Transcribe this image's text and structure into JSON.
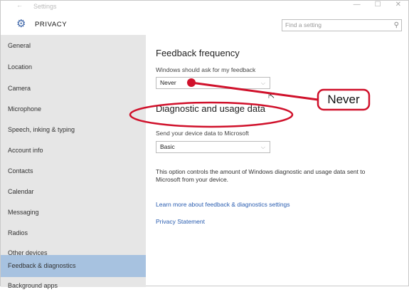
{
  "window": {
    "back_glyph": "←",
    "app_title": "Settings",
    "controls": [
      "—",
      "☐",
      "✕"
    ]
  },
  "header": {
    "section_title": "PRIVACY",
    "gear_glyph": "⚙",
    "search_placeholder": "Find a setting",
    "search_glyph": "⚲"
  },
  "sidebar": {
    "items": [
      {
        "label": "General"
      },
      {
        "label": "Location"
      },
      {
        "label": "Camera"
      },
      {
        "label": "Microphone"
      },
      {
        "label": "Speech, inking & typing"
      },
      {
        "label": "Account info"
      },
      {
        "label": "Contacts"
      },
      {
        "label": "Calendar"
      },
      {
        "label": "Messaging"
      },
      {
        "label": "Radios"
      },
      {
        "label": "Other devices"
      },
      {
        "label": "Feedback & diagnostics",
        "selected": true
      },
      {
        "label": "Background apps"
      }
    ]
  },
  "main": {
    "feedback_heading": "Feedback frequency",
    "feedback_label": "Windows should ask for my feedback",
    "feedback_value": "Never",
    "diagnostic_heading": "Diagnostic and usage data",
    "diagnostic_label": "Send your device data to Microsoft",
    "diagnostic_value": "Basic",
    "chevron_glyph": "⌵",
    "description": "This option controls the amount of Windows diagnostic and usage data sent to Microsoft from your device.",
    "learn_more_link": "Learn more about feedback & diagnostics settings",
    "privacy_link": "Privacy Statement"
  },
  "annotation": {
    "callout_text": "Never",
    "color": "#d0112b"
  }
}
